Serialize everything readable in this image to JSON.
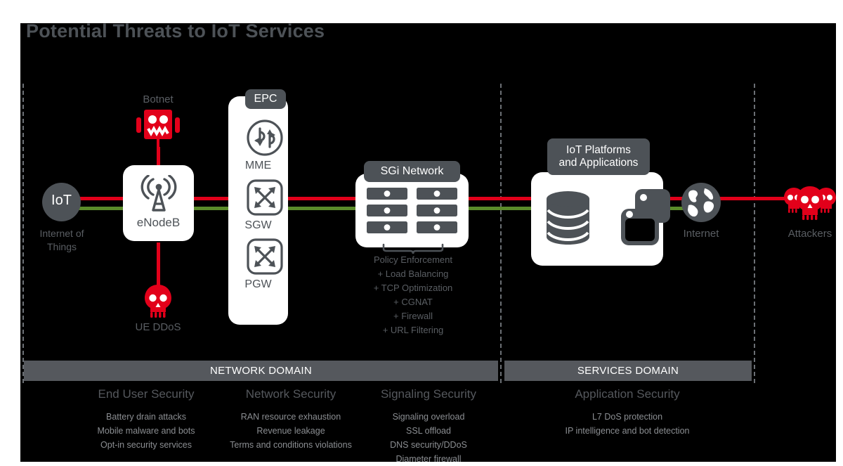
{
  "title": "Potential Threats to IoT Services",
  "colors": {
    "background": "#000000",
    "threat_red": "#e2001a",
    "data_green": "#5b8c2a",
    "node_gray": "#4d5257",
    "label_gray": "#5a5e63",
    "banner_gray": "#55585d"
  },
  "nodes": {
    "iot": {
      "label": "IoT",
      "caption_line1": "Internet of",
      "caption_line2": "Things",
      "icon": "iot-circle-icon"
    },
    "botnet": {
      "label": "Botnet",
      "icon": "robot-icon"
    },
    "ue_ddos": {
      "label": "UE DDoS",
      "icon": "skull-icon"
    },
    "enodeb": {
      "label": "eNodeB",
      "icon": "cell-tower-icon"
    },
    "epc": {
      "label": "EPC",
      "elements": [
        {
          "label": "MME",
          "icon": "mme-router-icon"
        },
        {
          "label": "SGW",
          "icon": "gateway-switch-icon"
        },
        {
          "label": "PGW",
          "icon": "gateway-switch-icon"
        }
      ]
    },
    "sgi": {
      "label": "SGi Network",
      "icon": "server-rack-icon",
      "features": [
        "Policy Enforcement",
        "+ Load Balancing",
        "+ TCP Optimization",
        "+ CGNAT",
        "+ Firewall",
        "+ URL Filtering"
      ]
    },
    "platforms": {
      "label_line1": "IoT Platforms",
      "label_line2": "and Applications",
      "icons": [
        "database-icon",
        "applications-windows-icon"
      ]
    },
    "internet": {
      "label": "Internet",
      "icon": "globe-icon"
    },
    "attackers": {
      "label": "Attackers",
      "icon": "skulls-icon"
    }
  },
  "domains": [
    {
      "banner": "NETWORK DOMAIN"
    },
    {
      "banner": "SERVICES DOMAIN"
    }
  ],
  "security_columns": [
    {
      "heading": "End User Security",
      "items": [
        "Battery drain attacks",
        "Mobile malware and bots",
        "Opt-in security services"
      ]
    },
    {
      "heading": "Network Security",
      "items": [
        "RAN resource exhaustion",
        "Revenue leakage",
        "Terms and conditions violations"
      ]
    },
    {
      "heading": "Signaling Security",
      "items": [
        "Signaling overload",
        "SSL offload",
        "DNS security/DDoS",
        "Diameter firewall"
      ]
    },
    {
      "heading": "Application Security",
      "items": [
        "L7 DoS protection",
        "IP intelligence and bot detection"
      ]
    }
  ]
}
